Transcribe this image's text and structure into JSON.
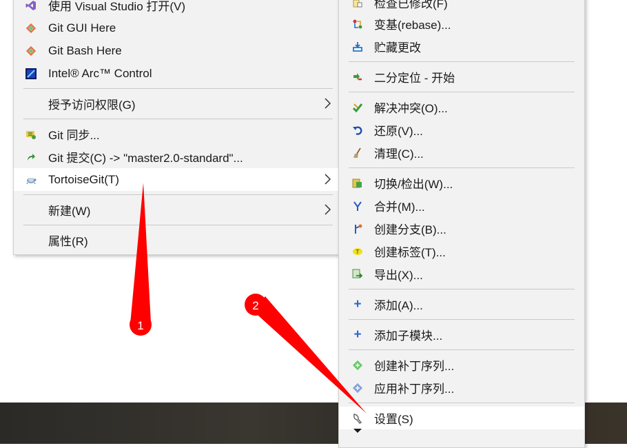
{
  "left_menu": {
    "items": [
      {
        "label": "使用 Visual Studio 打开(V)",
        "icon": "visual-studio-icon"
      },
      {
        "label": "Git GUI Here",
        "icon": "git-icon"
      },
      {
        "label": "Git Bash Here",
        "icon": "git-icon"
      },
      {
        "label": "Intel® Arc™ Control",
        "icon": "intel-arc-icon"
      },
      {
        "label": "授予访问权限(G)",
        "icon": ""
      },
      {
        "label": "Git 同步...",
        "icon": "git-sync-icon"
      },
      {
        "label": "Git 提交(C) -> \"master2.0-standard\"...",
        "icon": "git-commit-icon"
      },
      {
        "label": "TortoiseGit(T)",
        "icon": "tortoisegit-icon"
      },
      {
        "label": "新建(W)",
        "icon": ""
      },
      {
        "label": "属性(R)",
        "icon": ""
      }
    ]
  },
  "right_menu": {
    "items": [
      {
        "label": "检查已修改(F)",
        "icon": "check-modifications-icon"
      },
      {
        "label": "变基(rebase)...",
        "icon": "rebase-icon"
      },
      {
        "label": "贮藏更改",
        "icon": "stash-icon"
      },
      {
        "label": "二分定位 - 开始",
        "icon": "bisect-icon"
      },
      {
        "label": "解决冲突(O)...",
        "icon": "resolve-icon"
      },
      {
        "label": "还原(V)...",
        "icon": "revert-icon"
      },
      {
        "label": "清理(C)...",
        "icon": "cleanup-icon"
      },
      {
        "label": "切换/检出(W)...",
        "icon": "switch-icon"
      },
      {
        "label": "合并(M)...",
        "icon": "merge-icon"
      },
      {
        "label": "创建分支(B)...",
        "icon": "branch-icon"
      },
      {
        "label": "创建标签(T)...",
        "icon": "tag-icon"
      },
      {
        "label": "导出(X)...",
        "icon": "export-icon"
      },
      {
        "label": "添加(A)...",
        "icon": "add-icon"
      },
      {
        "label": "添加子模块...",
        "icon": "add-submodule-icon"
      },
      {
        "label": "创建补丁序列...",
        "icon": "create-patch-icon"
      },
      {
        "label": "应用补丁序列...",
        "icon": "apply-patch-icon"
      },
      {
        "label": "设置(S)",
        "icon": "settings-icon"
      }
    ]
  },
  "annotations": [
    {
      "number": "1",
      "color": "#ff0000"
    },
    {
      "number": "2",
      "color": "#ff0000"
    }
  ],
  "colors": {
    "menu_bg": "#f2f2f2",
    "highlight": "#ffffff",
    "arrow": "#ff0000"
  }
}
